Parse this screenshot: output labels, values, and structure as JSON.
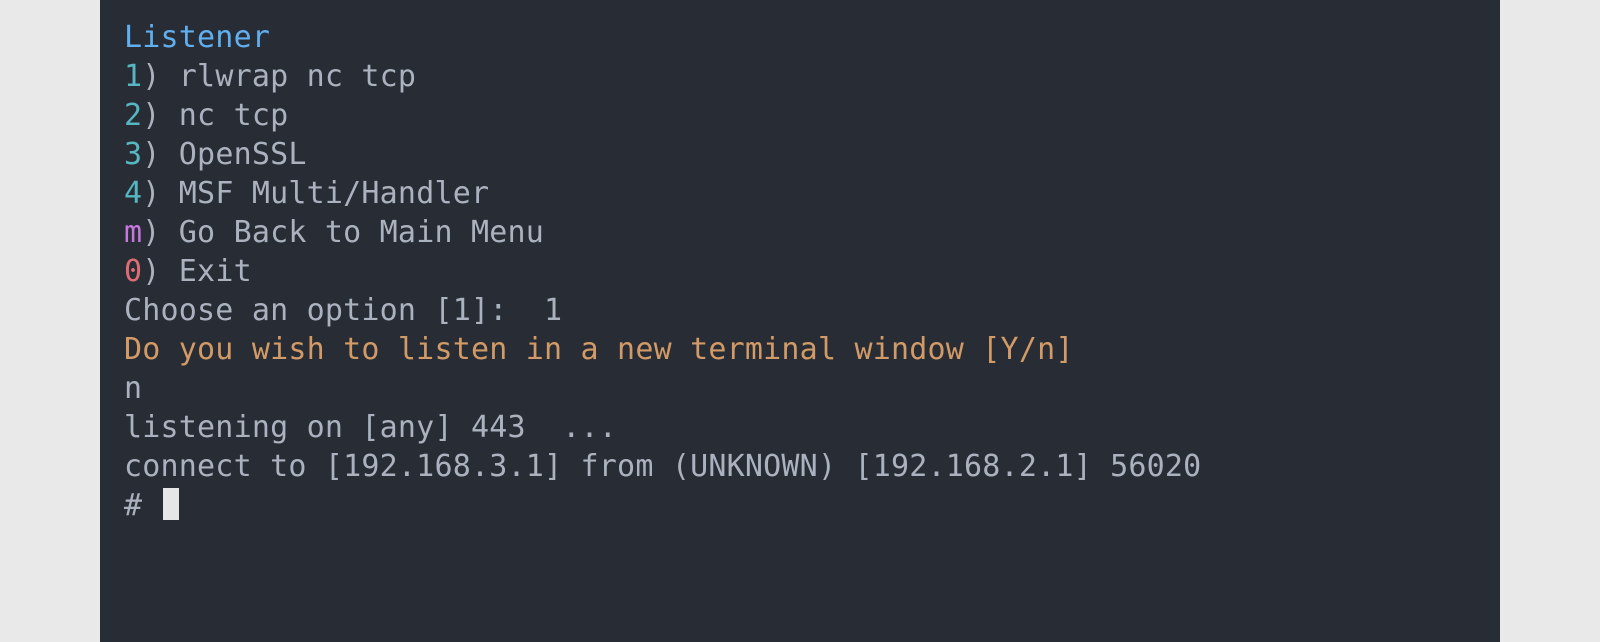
{
  "terminal": {
    "title": "Listener",
    "menu": {
      "items": [
        {
          "key": "1",
          "label": "rlwrap nc tcp",
          "keyClass": "num1"
        },
        {
          "key": "2",
          "label": "nc tcp",
          "keyClass": "num2"
        },
        {
          "key": "3",
          "label": "OpenSSL",
          "keyClass": "num3"
        },
        {
          "key": "4",
          "label": "MSF Multi/Handler",
          "keyClass": "num4"
        },
        {
          "key": "m",
          "label": "Go Back to Main Menu",
          "keyClass": "numM"
        },
        {
          "key": "0",
          "label": "Exit",
          "keyClass": "num0"
        }
      ],
      "paren": ")"
    },
    "choose_prompt": "Choose an option [1]:  ",
    "choose_input": "1",
    "question": "Do you wish to listen in a new terminal window [Y/n]",
    "question_answer": "n",
    "listening_line": "listening on [any] 443  ...",
    "connect_line": "connect to [192.168.3.1] from (UNKNOWN) [192.168.2.1] 56020",
    "shell_prompt": "# "
  }
}
